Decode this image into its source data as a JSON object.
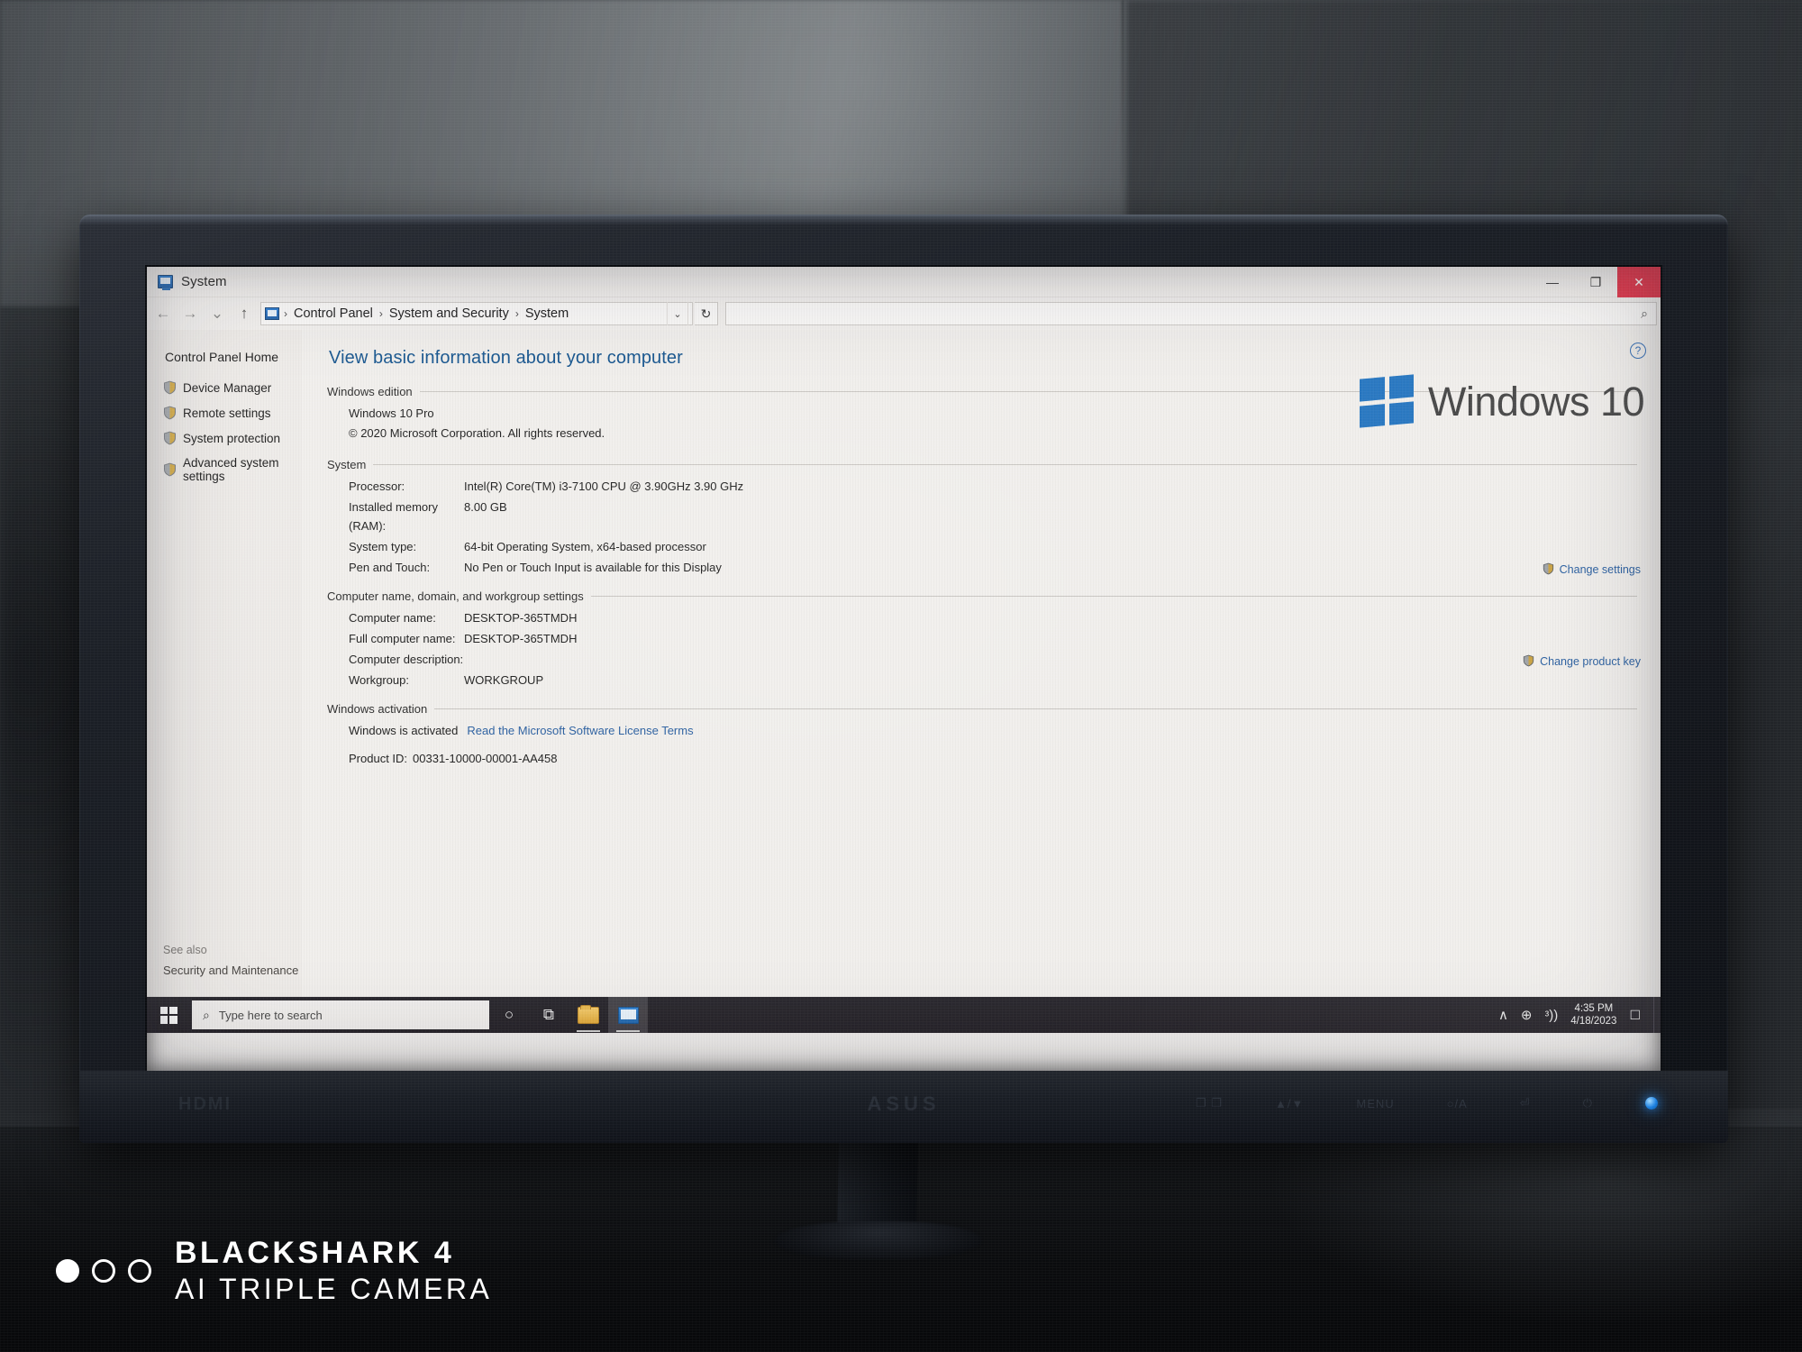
{
  "window": {
    "title": "System",
    "icon": "system-icon",
    "controls": {
      "minimize": "—",
      "maximize": "❐",
      "close": "✕"
    }
  },
  "address_bar": {
    "back": "←",
    "forward": "→",
    "recent": "⌄",
    "up": "↑",
    "breadcrumb": [
      "Control Panel",
      "System and Security",
      "System"
    ],
    "separator": "›",
    "chevron": "⌄",
    "refresh": "↻",
    "search_value": "",
    "search_placeholder": "",
    "search_icon": "⌕"
  },
  "sidebar": {
    "home": "Control Panel Home",
    "items": [
      {
        "label": "Device Manager",
        "icon": "shield-icon"
      },
      {
        "label": "Remote settings",
        "icon": "shield-icon"
      },
      {
        "label": "System protection",
        "icon": "shield-icon"
      },
      {
        "label": "Advanced system settings",
        "icon": "shield-icon"
      }
    ],
    "see_also_title": "See also",
    "see_also_link": "Security and Maintenance"
  },
  "main": {
    "heading": "View basic information about your computer",
    "help_icon": "?",
    "sections": {
      "edition": {
        "title": "Windows edition",
        "lines": [
          "Windows 10 Pro",
          "© 2020 Microsoft Corporation. All rights reserved."
        ],
        "logo_text": "Windows 10",
        "logo_color": "#2b79c2"
      },
      "system": {
        "title": "System",
        "rows": [
          {
            "label": "Processor:",
            "value": "Intel(R) Core(TM) i3-7100 CPU @ 3.90GHz   3.90 GHz"
          },
          {
            "label": "Installed memory (RAM):",
            "value": "8.00 GB"
          },
          {
            "label": "System type:",
            "value": "64-bit Operating System, x64-based processor"
          },
          {
            "label": "Pen and Touch:",
            "value": "No Pen or Touch Input is available for this Display"
          }
        ]
      },
      "computer_name": {
        "title": "Computer name, domain, and workgroup settings",
        "rows": [
          {
            "label": "Computer name:",
            "value": "DESKTOP-365TMDH"
          },
          {
            "label": "Full computer name:",
            "value": "DESKTOP-365TMDH"
          },
          {
            "label": "Computer description:",
            "value": ""
          },
          {
            "label": "Workgroup:",
            "value": "WORKGROUP"
          }
        ],
        "change_link": "Change settings"
      },
      "activation": {
        "title": "Windows activation",
        "status": "Windows is activated",
        "license_link": "Read the Microsoft Software License Terms",
        "product_id_label": "Product ID:",
        "product_id_value": "00331-10000-00001-AA458",
        "change_link": "Change product key"
      }
    }
  },
  "taskbar": {
    "start_icon": "windows-start-icon",
    "search_placeholder": "Type here to search",
    "search_icon": "⌕",
    "items": [
      {
        "name": "cortana-icon",
        "glyph": "○"
      },
      {
        "name": "task-view-icon",
        "glyph": "⧉"
      },
      {
        "name": "file-explorer-icon",
        "glyph": ""
      },
      {
        "name": "system-window-icon",
        "glyph": ""
      }
    ],
    "tray": {
      "expand": "∧",
      "network": "⊕",
      "volume": "ᵌ))",
      "time": "4:35 PM",
      "date": "4/18/2023",
      "action_center": "⬜"
    }
  },
  "monitor": {
    "brand": "ASUS",
    "port_label": "HDMI",
    "osd_buttons": [
      "❐ ❐",
      "▲/▼",
      "MENU",
      "○/A",
      "⏎",
      "⏻"
    ]
  },
  "watermark": {
    "line1": "BLACKSHARK 4",
    "line2": "AI TRIPLE CAMERA",
    "dots": 3
  }
}
